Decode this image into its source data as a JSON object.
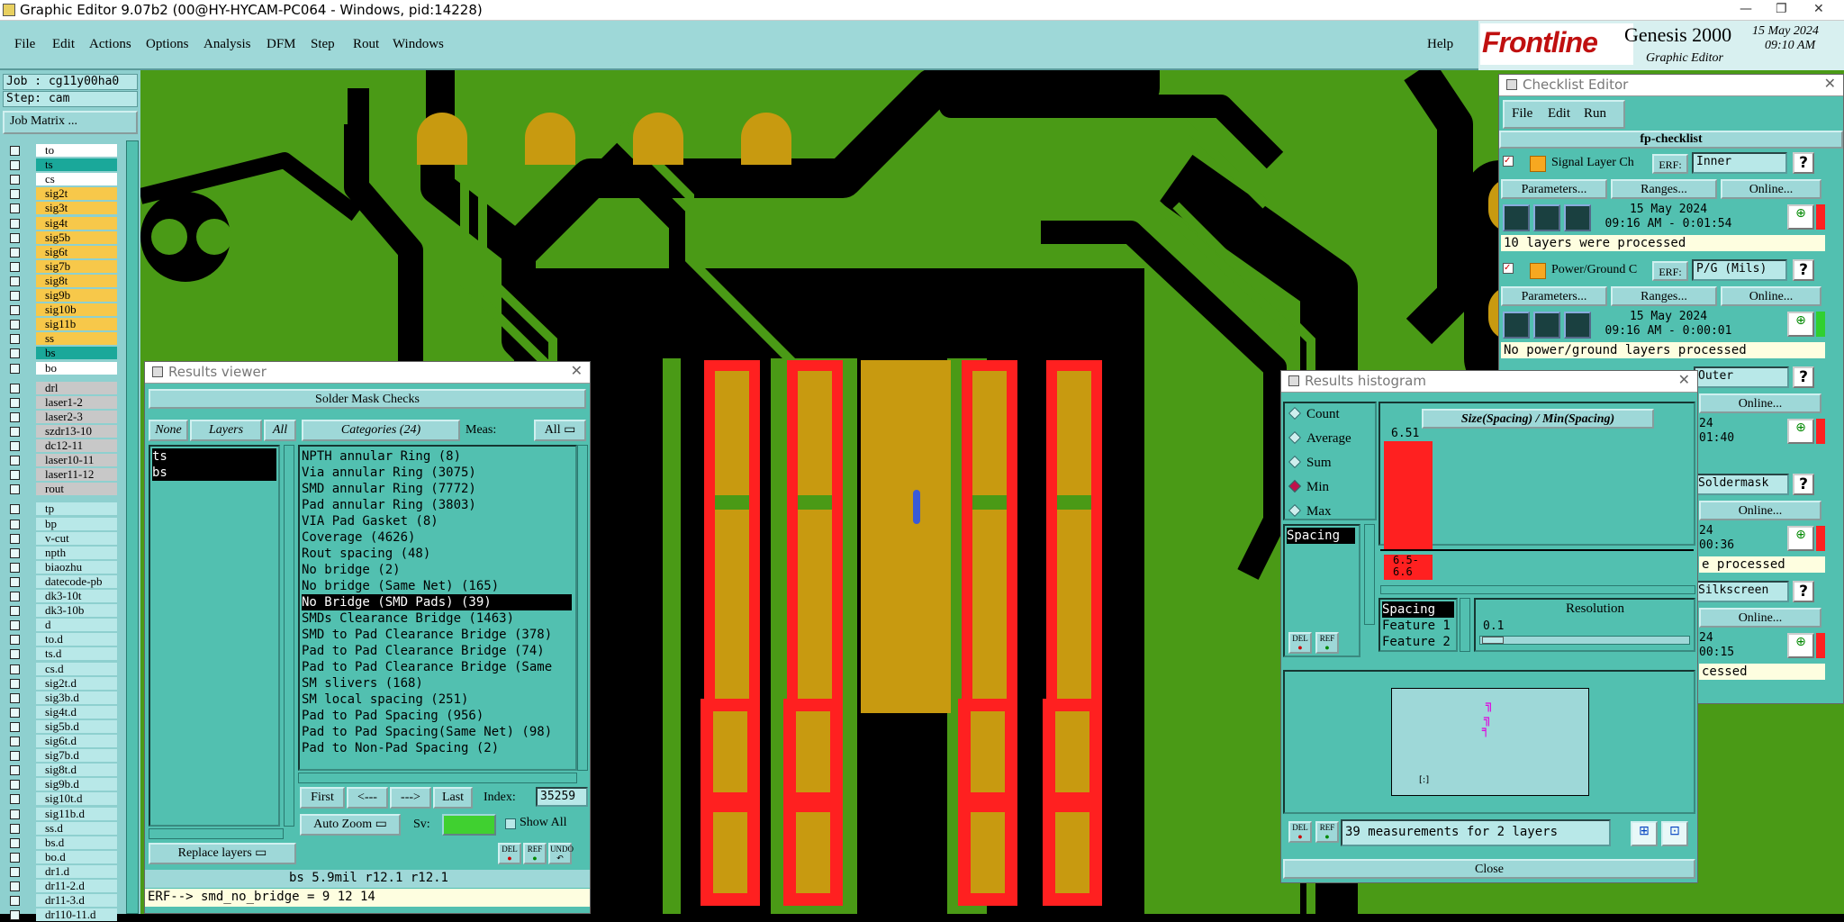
{
  "window": {
    "title": "Graphic Editor 9.07b2 (00@HY-HYCAM-PC064 - Windows, pid:14228)"
  },
  "menu": [
    "File",
    "Edit",
    "Actions",
    "Options",
    "Analysis",
    "DFM",
    "Step",
    "Rout",
    "Windows"
  ],
  "help": "Help",
  "brand": {
    "logo": "Frontline",
    "product": "Genesis 2000",
    "subtitle": "Graphic Editor",
    "date": "15 May 2024",
    "time": "09:10 AM"
  },
  "job": {
    "job": "Job : cg11y00ha0",
    "step": "Step: cam",
    "matrix_button": "Job Matrix ..."
  },
  "layers": [
    {
      "name": "to",
      "color": "#ffffff"
    },
    {
      "name": "ts",
      "color": "#1aa89a"
    },
    {
      "name": "cs",
      "color": "#ffffff"
    },
    {
      "name": "sig2t",
      "color": "#f7c84a"
    },
    {
      "name": "sig3t",
      "color": "#f7c84a"
    },
    {
      "name": "sig4t",
      "color": "#f7c84a"
    },
    {
      "name": "sig5b",
      "color": "#f7c84a"
    },
    {
      "name": "sig6t",
      "color": "#f7c84a"
    },
    {
      "name": "sig7b",
      "color": "#f7c84a"
    },
    {
      "name": "sig8t",
      "color": "#f7c84a"
    },
    {
      "name": "sig9b",
      "color": "#f7c84a"
    },
    {
      "name": "sig10b",
      "color": "#f7c84a"
    },
    {
      "name": "sig11b",
      "color": "#f7c84a"
    },
    {
      "name": "ss",
      "color": "#f7c84a"
    },
    {
      "name": "bs",
      "color": "#1aa89a"
    },
    {
      "name": "bo",
      "color": "#ffffff"
    },
    {
      "name": "drl",
      "color": "#c8c8c8"
    },
    {
      "name": "laser1-2",
      "color": "#c8c8c8"
    },
    {
      "name": "laser2-3",
      "color": "#c8c8c8"
    },
    {
      "name": "szdr13-10",
      "color": "#c8c8c8"
    },
    {
      "name": "dc12-11",
      "color": "#c8c8c8"
    },
    {
      "name": "laser10-11",
      "color": "#c8c8c8"
    },
    {
      "name": "laser11-12",
      "color": "#c8c8c8"
    },
    {
      "name": "rout",
      "color": "#c8c8c8"
    },
    {
      "name": "tp",
      "color": "#b8e8e8"
    },
    {
      "name": "bp",
      "color": "#b8e8e8"
    },
    {
      "name": "v-cut",
      "color": "#b8e8e8"
    },
    {
      "name": "npth",
      "color": "#b8e8e8"
    },
    {
      "name": "biaozhu",
      "color": "#b8e8e8"
    },
    {
      "name": "datecode-pb",
      "color": "#b8e8e8"
    },
    {
      "name": "dk3-10t",
      "color": "#b8e8e8"
    },
    {
      "name": "dk3-10b",
      "color": "#b8e8e8"
    },
    {
      "name": "d",
      "color": "#b8e8e8"
    },
    {
      "name": "to.d",
      "color": "#b8e8e8"
    },
    {
      "name": "ts.d",
      "color": "#b8e8e8"
    },
    {
      "name": "cs.d",
      "color": "#b8e8e8"
    },
    {
      "name": "sig2t.d",
      "color": "#b8e8e8"
    },
    {
      "name": "sig3b.d",
      "color": "#b8e8e8"
    },
    {
      "name": "sig4t.d",
      "color": "#b8e8e8"
    },
    {
      "name": "sig5b.d",
      "color": "#b8e8e8"
    },
    {
      "name": "sig6t.d",
      "color": "#b8e8e8"
    },
    {
      "name": "sig7b.d",
      "color": "#b8e8e8"
    },
    {
      "name": "sig8t.d",
      "color": "#b8e8e8"
    },
    {
      "name": "sig9b.d",
      "color": "#b8e8e8"
    },
    {
      "name": "sig10t.d",
      "color": "#b8e8e8"
    },
    {
      "name": "sig11b.d",
      "color": "#b8e8e8"
    },
    {
      "name": "ss.d",
      "color": "#b8e8e8"
    },
    {
      "name": "bs.d",
      "color": "#b8e8e8"
    },
    {
      "name": "bo.d",
      "color": "#b8e8e8"
    },
    {
      "name": "dr1.d",
      "color": "#b8e8e8"
    },
    {
      "name": "dr11-2.d",
      "color": "#b8e8e8"
    },
    {
      "name": "dr11-3.d",
      "color": "#b8e8e8"
    },
    {
      "name": "dr110-11.d",
      "color": "#b8e8e8"
    }
  ],
  "results_viewer": {
    "title": "Results viewer",
    "header": "Solder Mask Checks",
    "none": "None",
    "layers": "Layers",
    "all": "All",
    "categories": "Categories (24)",
    "meas_label": "Meas:",
    "meas_value": "All",
    "layer_items": [
      "ts",
      "bs"
    ],
    "category_items": [
      "NPTH annular Ring (8)",
      "Via annular Ring (3075)",
      "SMD annular Ring (7772)",
      "Pad annular Ring (3803)",
      "VIA Pad Gasket (8)",
      "Coverage (4626)",
      "Rout spacing (48)",
      "No bridge (2)",
      "No bridge (Same Net) (165)",
      "No Bridge (SMD Pads) (39)",
      "SMDs Clearance Bridge (1463)",
      "SMD to Pad Clearance Bridge (378)",
      "Pad to Pad Clearance Bridge (74)",
      "Pad to Pad Clearance Bridge (Same",
      "SM slivers (168)",
      "SM local spacing (251)",
      "Pad to Pad Spacing (956)",
      "Pad to Pad Spacing(Same Net) (98)",
      "Pad to Non-Pad Spacing (2)"
    ],
    "first": "First",
    "prev": "<---",
    "next": "--->",
    "last": "Last",
    "index_label": "Index:",
    "index_value": "35259",
    "auto_zoom": "Auto Zoom",
    "sv_label": "Sv:",
    "show_all": "Show All",
    "replace_layers": "Replace layers",
    "status": "bs 5.9mil  r12.1  r12.1",
    "erf": "ERF--> smd_no_bridge = 9 12 14"
  },
  "histogram": {
    "title": "Results histogram",
    "modes": [
      "Count",
      "Average",
      "Sum",
      "Min",
      "Max"
    ],
    "selected_mode": "Min",
    "chart_title": "Size(Spacing) / Min(Spacing)",
    "bar_top_label": "6.51",
    "range_label": "6.5-\n6.6",
    "list_item": "Spacing",
    "resolution_items": [
      "Spacing",
      "Feature 1",
      "Feature 2"
    ],
    "resolution_label": "Resolution",
    "resolution_value": "0.1",
    "measurements": "39 measurements for 2 layers",
    "close": "Close"
  },
  "checklist": {
    "title": "Checklist Editor",
    "menu": [
      "File",
      "Edit",
      "Run"
    ],
    "name": "fp-checklist",
    "checks": [
      {
        "name": "Signal Layer Ch",
        "erf": "Inner",
        "date": "15 May 2024",
        "time": "09:16 AM - 0:01:54",
        "msg": "10 layers were processed"
      },
      {
        "name": "Power/Ground C",
        "erf": "P/G (Mils)",
        "date": "15 May 2024",
        "time": "09:16 AM - 0:00:01",
        "msg": "No power/ground layers processed"
      }
    ],
    "partial": [
      {
        "erf": "Outer",
        "time_tail": "24",
        "time2": "01:40"
      },
      {
        "erf": "Soldermask",
        "time_tail": "24",
        "time2": "00:36",
        "msg": "e processed"
      },
      {
        "erf": "Silkscreen",
        "time_tail": "24",
        "time2": "00:15",
        "msg": "cessed"
      }
    ],
    "erf_label": "ERF:",
    "parameters": "Parameters...",
    "ranges": "Ranges...",
    "online": "Online..."
  },
  "colors": {
    "board": "#4a9a16",
    "copper": "#c89a10",
    "mask": "#ff2020",
    "panel": "#52c0b0",
    "menu": "#9ed8d8"
  }
}
